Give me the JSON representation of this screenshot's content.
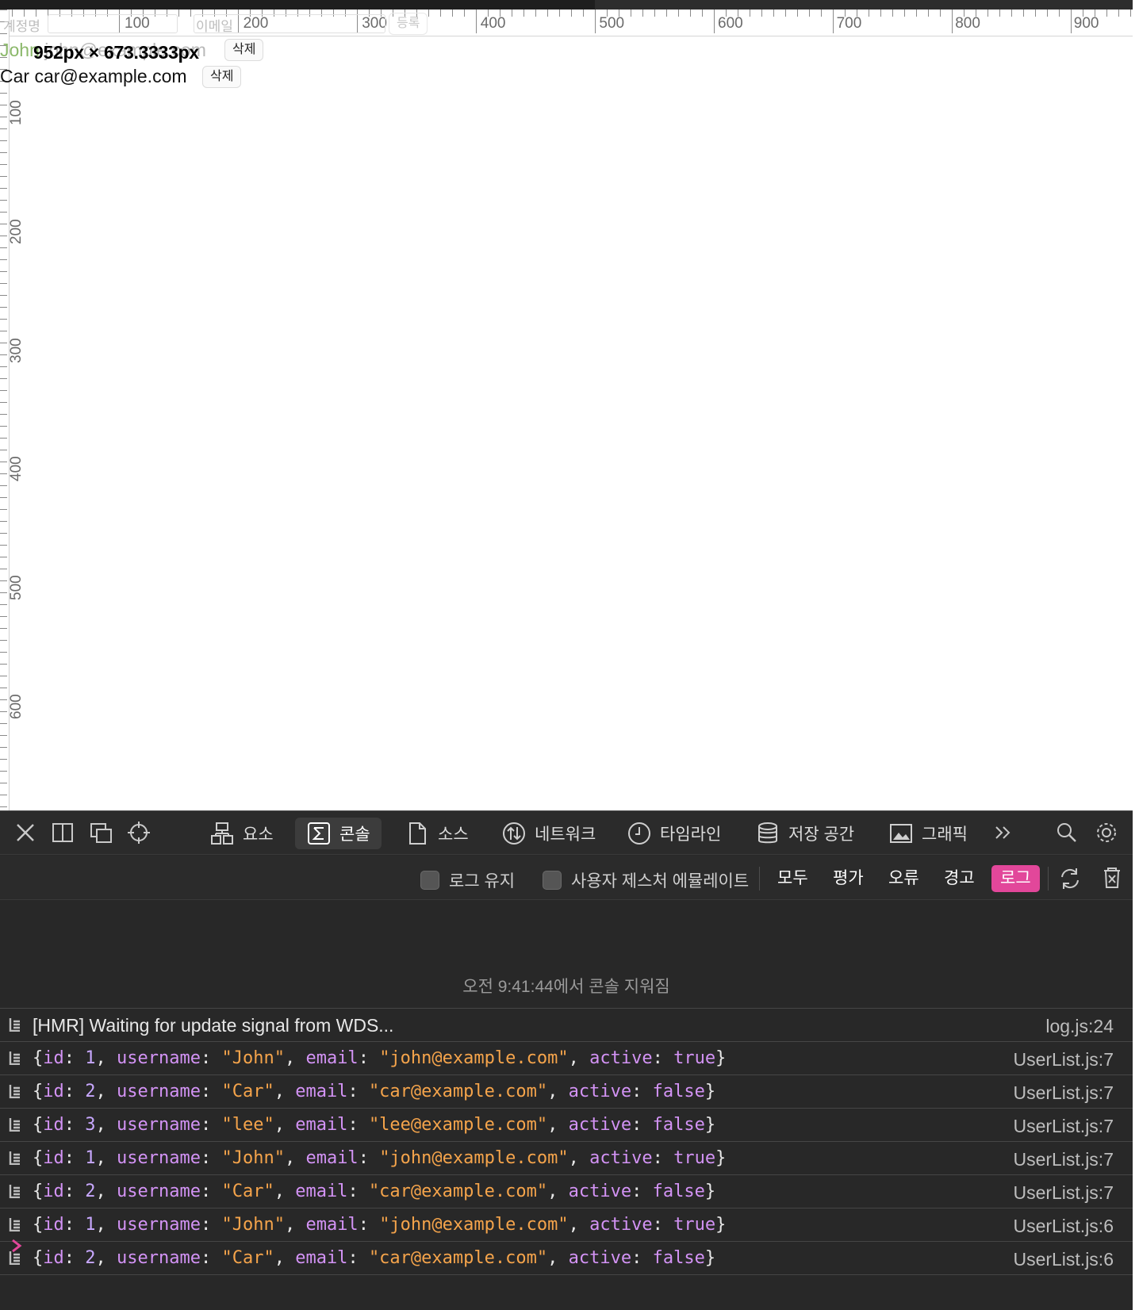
{
  "page": {
    "ghost_labels": {
      "name_header": "계정명",
      "email_header": "이메일",
      "register_button": "등록"
    },
    "users": [
      {
        "name": "John",
        "email": "john@example.com",
        "delete_label": "삭제"
      },
      {
        "name": "Car",
        "email": "car@example.com",
        "delete_label": "삭제"
      }
    ],
    "measure_overlay": "952px × 673.3333px",
    "ruler_labels_horizontal": [
      "100",
      "200",
      "300",
      "400",
      "500",
      "600",
      "700",
      "800",
      "900"
    ],
    "ruler_labels_vertical": [
      "100",
      "200",
      "300",
      "400",
      "500",
      "600"
    ]
  },
  "devtools": {
    "tabs": [
      {
        "label": "요소",
        "icon": "elements-icon"
      },
      {
        "label": "콘솔",
        "icon": "console-icon",
        "active": true
      },
      {
        "label": "소스",
        "icon": "sources-icon"
      },
      {
        "label": "네트워크",
        "icon": "network-icon"
      },
      {
        "label": "타임라인",
        "icon": "timeline-icon"
      },
      {
        "label": "저장 공간",
        "icon": "storage-icon"
      },
      {
        "label": "그래픽",
        "icon": "graphics-icon"
      }
    ],
    "filters": {
      "preserve_log": "로그 유지",
      "emulate_gesture": "사용자 제스처 에뮬레이트",
      "levels": [
        "모두",
        "평가",
        "오류",
        "경고",
        "로그"
      ],
      "active_level": "로그"
    },
    "console": {
      "cleared_message": "오전 9:41:44에서 콘솔 지워짐",
      "entries": [
        {
          "text": "[HMR] Waiting for update signal from WDS...",
          "source": "log.js:24"
        },
        {
          "id": "1",
          "username": "\"John\"",
          "email": "\"john@example.com\"",
          "active": "true",
          "source": "UserList.js:7"
        },
        {
          "id": "2",
          "username": "\"Car\"",
          "email": "\"car@example.com\"",
          "active": "false",
          "source": "UserList.js:7"
        },
        {
          "id": "3",
          "username": "\"lee\"",
          "email": "\"lee@example.com\"",
          "active": "false",
          "source": "UserList.js:7"
        },
        {
          "id": "1",
          "username": "\"John\"",
          "email": "\"john@example.com\"",
          "active": "true",
          "source": "UserList.js:7"
        },
        {
          "id": "2",
          "username": "\"Car\"",
          "email": "\"car@example.com\"",
          "active": "false",
          "source": "UserList.js:7"
        },
        {
          "id": "1",
          "username": "\"John\"",
          "email": "\"john@example.com\"",
          "active": "true",
          "source": "UserList.js:6"
        },
        {
          "id": "2",
          "username": "\"Car\"",
          "email": "\"car@example.com\"",
          "active": "false",
          "source": "UserList.js:6"
        }
      ]
    },
    "colors": {
      "accent": "#e2479a",
      "key": "#d393f5",
      "string": "#f5a44b"
    }
  }
}
